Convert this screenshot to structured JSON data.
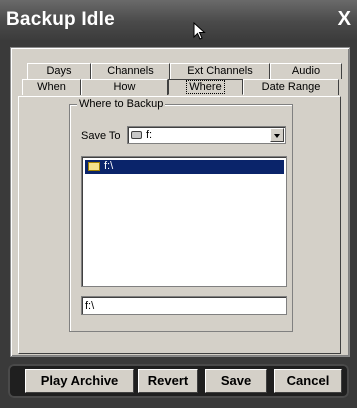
{
  "window": {
    "title": "Backup Idle",
    "close_label": "X"
  },
  "tabs_row1": [
    "Days",
    "Channels",
    "Ext Channels",
    "Audio"
  ],
  "tabs_row2": [
    "When",
    "How",
    "Where",
    "Date Range"
  ],
  "active_tab": "Where",
  "where": {
    "group_label": "Where to Backup",
    "save_to_label": "Save To",
    "save_to_value": "f:",
    "directory_items": [
      "f:\\"
    ],
    "selected_directory": "f:\\",
    "path_value": "f:\\"
  },
  "buttons": {
    "play_archive": "Play Archive",
    "revert": "Revert",
    "save": "Save",
    "cancel": "Cancel"
  }
}
